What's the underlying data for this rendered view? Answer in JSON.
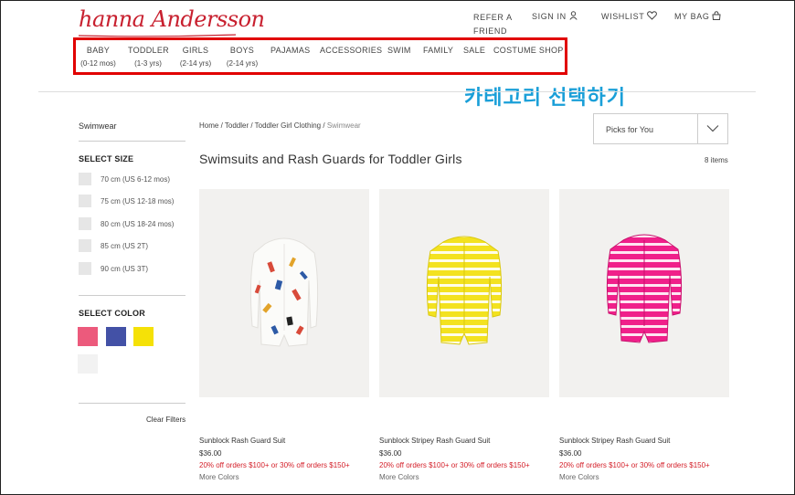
{
  "header": {
    "logo_text": "hanna Andersson",
    "refer": "REFER A FRIEND",
    "signin": "SIGN IN",
    "wishlist": "WISHLIST",
    "mybag": "MY BAG"
  },
  "nav": [
    {
      "label": "BABY",
      "sub": "(0-12 mos)"
    },
    {
      "label": "TODDLER",
      "sub": "(1-3 yrs)"
    },
    {
      "label": "GIRLS",
      "sub": "(2-14 yrs)"
    },
    {
      "label": "BOYS",
      "sub": "(2-14 yrs)"
    },
    {
      "label": "PAJAMAS",
      "sub": ""
    },
    {
      "label": "ACCESSORIES",
      "sub": ""
    },
    {
      "label": "SWIM",
      "sub": ""
    },
    {
      "label": "FAMILY",
      "sub": ""
    },
    {
      "label": "SALE",
      "sub": ""
    },
    {
      "label": "COSTUME SHOP",
      "sub": ""
    }
  ],
  "annotation": "카테고리 선택하기",
  "sidebar": {
    "title": "Swimwear",
    "size_heading": "SELECT SIZE",
    "sizes": [
      "70 cm (US 6-12 mos)",
      "75 cm (US 12-18 mos)",
      "80 cm (US 18-24 mos)",
      "85 cm (US 2T)",
      "90 cm (US 3T)"
    ],
    "color_heading": "SELECT COLOR",
    "colors": [
      "#ec5a7c",
      "#4351a6",
      "#f5e107",
      "#f2f2f2"
    ],
    "clear": "Clear Filters"
  },
  "breadcrumb": {
    "home": "Home",
    "toddler": "Toddler",
    "clothing": "Toddler Girl Clothing",
    "current": "Swimwear",
    "sep": " / "
  },
  "sort_label": "Picks for You",
  "page_title": "Swimsuits and Rash Guards for Toddler Girls",
  "item_count": "8 items",
  "products": [
    {
      "name": "Sunblock Rash Guard Suit",
      "price": "$36.00",
      "promo": "20% off orders $100+ or 30% off orders $150+",
      "more": "More Colors"
    },
    {
      "name": "Sunblock Stripey Rash Guard Suit",
      "price": "$36.00",
      "promo": "20% off orders $100+ or 30% off orders $150+",
      "more": "More Colors"
    },
    {
      "name": "Sunblock Stripey Rash Guard Suit",
      "price": "$36.00",
      "promo": "20% off orders $100+ or 30% off orders $150+",
      "more": "More Colors"
    }
  ]
}
